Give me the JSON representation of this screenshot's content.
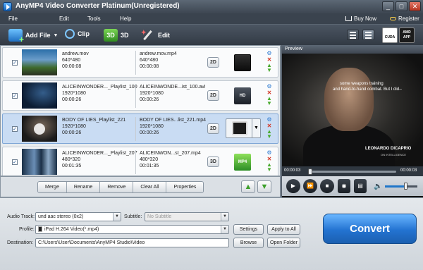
{
  "window": {
    "title": "AnyMP4 Video Converter Platinum(Unregistered)",
    "controls": [
      "_",
      "□",
      "✕"
    ]
  },
  "menu": {
    "items": [
      "File",
      "Edit",
      "Tools",
      "Help"
    ],
    "buy_now": "Buy Now",
    "register": "Register"
  },
  "toolbar": {
    "add_file": "Add File",
    "clip": "Clip",
    "three_d": "3D",
    "edit": "Edit",
    "cuda_label": "CUDA",
    "amd_label": "AMD",
    "app_label": "APP"
  },
  "files": [
    {
      "checked": true,
      "src_name": "andrew.mov",
      "src_res": "640*480",
      "src_dur": "00:00:08",
      "dst_name": "andrew.mov.mp4",
      "dst_res": "640*480",
      "dst_dur": "00:00:08",
      "mode": "2D",
      "format_icon": "mov-film-icon",
      "selected": false
    },
    {
      "checked": true,
      "src_name": "ALICEINWONDER..._Playlist_100",
      "src_res": "1920*1080",
      "src_dur": "00:00:26",
      "dst_name": "ALICEINWONDE...ist_100.avi",
      "dst_res": "1920*1080",
      "dst_dur": "00:00:26",
      "mode": "2D",
      "format_icon": "hd-avi-icon",
      "format_text": "HD",
      "selected": false
    },
    {
      "checked": true,
      "src_name": "BODY OF LIES_Playlist_221",
      "src_res": "1920*1080",
      "src_dur": "00:00:26",
      "dst_name": "BODY OF LIES...list_221.mp4",
      "dst_res": "1920*1080",
      "dst_dur": "00:00:26",
      "mode": "2D",
      "format_icon": "ipad-icon",
      "selected": true
    },
    {
      "checked": true,
      "src_name": "ALICEINWONDER..._Playlist_207",
      "src_res": "480*320",
      "src_dur": "00:01:35",
      "dst_name": "ALICEINWON...st_207.mp4",
      "dst_res": "480*320",
      "dst_dur": "00:01:35",
      "mode": "3D",
      "format_icon": "mp4-3d-icon",
      "format_text": "MP4",
      "selected": false
    }
  ],
  "actions": [
    "Merge",
    "Rename",
    "Remove",
    "Clear All",
    "Properties"
  ],
  "preview": {
    "title": "Preview",
    "subtitle_line1": "some weapons training",
    "subtitle_line2": "and hand-to-hand combat. But I did--",
    "caption_name": "LEONARDO DICAPRIO",
    "caption_sub": "ON INTELLIGENCE",
    "time_current": "00:00:03",
    "time_total": "00:00:03",
    "volume_level": 0.65
  },
  "settings": {
    "audio_track_label": "Audio Track:",
    "audio_track_value": "und aac stereo (0x2)",
    "subtitle_label": "Subtitle:",
    "subtitle_value": "No Subtitle",
    "profile_label": "Profile:",
    "profile_value": "iPad H.264 Video(*.mp4)",
    "settings_btn": "Settings",
    "apply_all_btn": "Apply to All",
    "destination_label": "Destination:",
    "destination_value": "C:\\Users\\User\\Documents\\AnyMP4 Studio\\Video",
    "browse_btn": "Browse",
    "open_folder_btn": "Open Folder",
    "convert_btn": "Convert"
  }
}
